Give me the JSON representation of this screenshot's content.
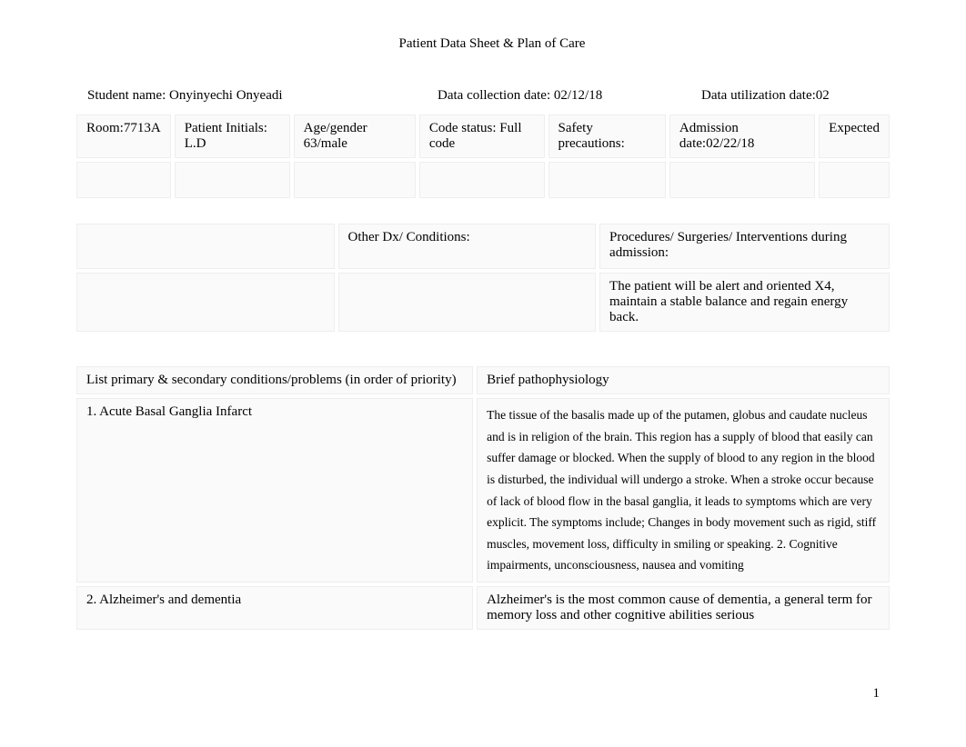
{
  "title": "Patient Data Sheet & Plan of Care",
  "header": {
    "student": "Student name: Onyinyechi Onyeadi",
    "collection": "Data collection date:    02/12/18",
    "utilization": "Data utilization date:02"
  },
  "table1": {
    "room": "Room:7713A",
    "initials": "Patient Initials: L.D",
    "age_gender": "Age/gender 63/male",
    "code_status": "Code status: Full code",
    "safety": "Safety precautions:",
    "admission": "Admission date:02/22/18",
    "expected": "Expected"
  },
  "table2": {
    "c1r1": "",
    "c2r1": "Other Dx/ Conditions:",
    "c3r1": "Procedures/ Surgeries/ Interventions during admission:",
    "c1r2": "",
    "c2r2": "",
    "c3r2": "The patient will be alert and oriented X4, maintain a stable balance and regain energy back."
  },
  "table3": {
    "hdr1": "List primary & secondary conditions/problems  (in order of priority)",
    "hdr2": "Brief pathophysiology",
    "r1c1": "1. Acute Basal Ganglia Infarct",
    "r1c2": "The tissue of the basalis made up of the putamen, globus and caudate nucleus and is in religion of the brain. This region has a supply of blood that easily can  suffer damage or blocked. When the supply of blood to any region in the blood is disturbed, the individual will undergo a stroke. When a stroke occur because of lack of blood flow in the basal ganglia, it leads to symptoms which are very explicit. The symptoms include; Changes in body movement such as rigid, stiff muscles, movement loss, difficulty in smiling or speaking. 2. Cognitive impairments, unconsciousness, nausea and vomiting",
    "r2c1": "2. Alzheimer's and dementia",
    "r2c2": "Alzheimer's  is the most common cause of dementia, a general term for memory loss and other cognitive abilities serious"
  },
  "page_number": "1"
}
